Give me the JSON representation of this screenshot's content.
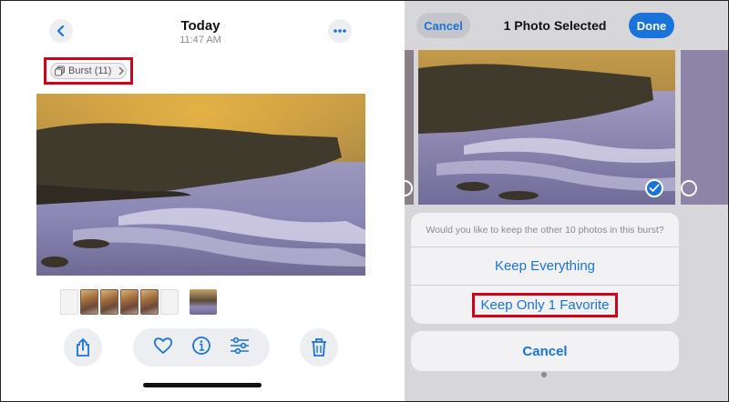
{
  "left": {
    "title": "Today",
    "time": "11:47 AM",
    "burst_label": "Burst (11)",
    "icons": {
      "back": "chevron-left-icon",
      "more": "ellipsis-icon",
      "share": "share-icon",
      "favorite": "heart-icon",
      "info": "info-icon",
      "adjust": "sliders-icon",
      "delete": "trash-icon"
    }
  },
  "right": {
    "nav": {
      "cancel_label": "Cancel",
      "title": "1 Photo Selected",
      "done_label": "Done"
    },
    "sheet": {
      "message": "Would you like to keep the other 10 photos in this burst?",
      "keep_everything": "Keep Everything",
      "keep_favorite": "Keep Only 1 Favorite",
      "cancel": "Cancel"
    }
  },
  "colors": {
    "accent": "#1a73d9",
    "highlight": "#d0021b"
  }
}
